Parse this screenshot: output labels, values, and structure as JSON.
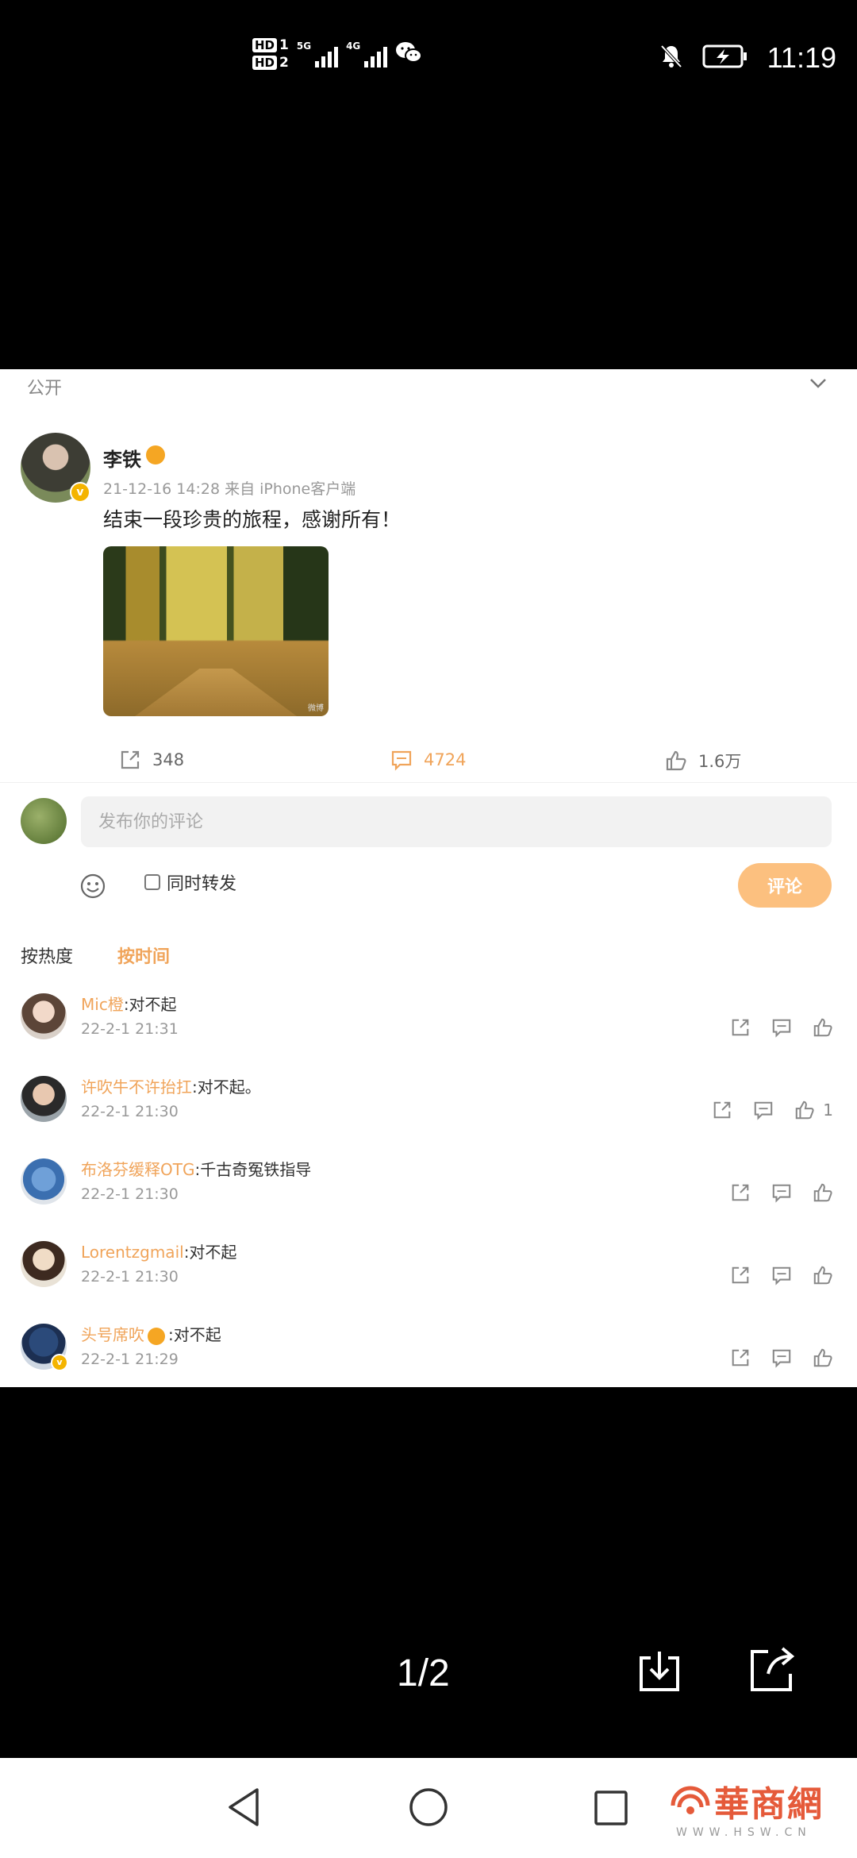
{
  "status_bar": {
    "hd1": "HD",
    "sim1": "1",
    "hd2": "HD",
    "sim2": "2",
    "net1": "5G",
    "net2": "4G",
    "time": "11:19"
  },
  "post": {
    "visibility": "公开",
    "author": "李铁",
    "meta": "21-12-16 14:28 来自 iPhone客户端",
    "text": "结束一段珍贵的旅程，感谢所有！",
    "image_watermark": "微博",
    "repost_count": "348",
    "comment_count": "4724",
    "like_count": "1.6万"
  },
  "composer": {
    "placeholder": "发布你的评论",
    "repost_label": "同时转发",
    "submit_label": "评论"
  },
  "sort": {
    "by_hot": "按热度",
    "by_time": "按时间"
  },
  "comments": [
    {
      "user": "Mic橙",
      "text": ":对不起",
      "time": "22-2-1 21:31",
      "likes": ""
    },
    {
      "user": "许吹牛不许抬扛",
      "text": ":对不起。",
      "time": "22-2-1 21:30",
      "likes": "1"
    },
    {
      "user": "布洛芬缓释OTG",
      "text": ":千古奇冤铁指导",
      "time": "22-2-1 21:30",
      "likes": ""
    },
    {
      "user": "Lorentzgmail",
      "text": ":对不起",
      "time": "22-2-1 21:30",
      "likes": ""
    },
    {
      "user": "头号席吹",
      "text": ":对不起",
      "time": "22-2-1 21:29",
      "likes": ""
    }
  ],
  "viewer": {
    "page_indicator": "1/2"
  },
  "watermark": {
    "brand_cn": "華商網",
    "brand_url": "WWW.HSW.CN"
  },
  "icons": [
    "bell-off-icon",
    "battery-charging-icon",
    "wechat-icon",
    "chevron-down-icon",
    "share-icon",
    "comment-icon",
    "like-icon",
    "emoji-icon",
    "download-icon",
    "external-share-icon",
    "back-icon",
    "home-icon",
    "recent-apps-icon"
  ],
  "colors": {
    "accent": "#f0a45a",
    "button": "#fcc07f",
    "brand": "#e55a3a"
  }
}
